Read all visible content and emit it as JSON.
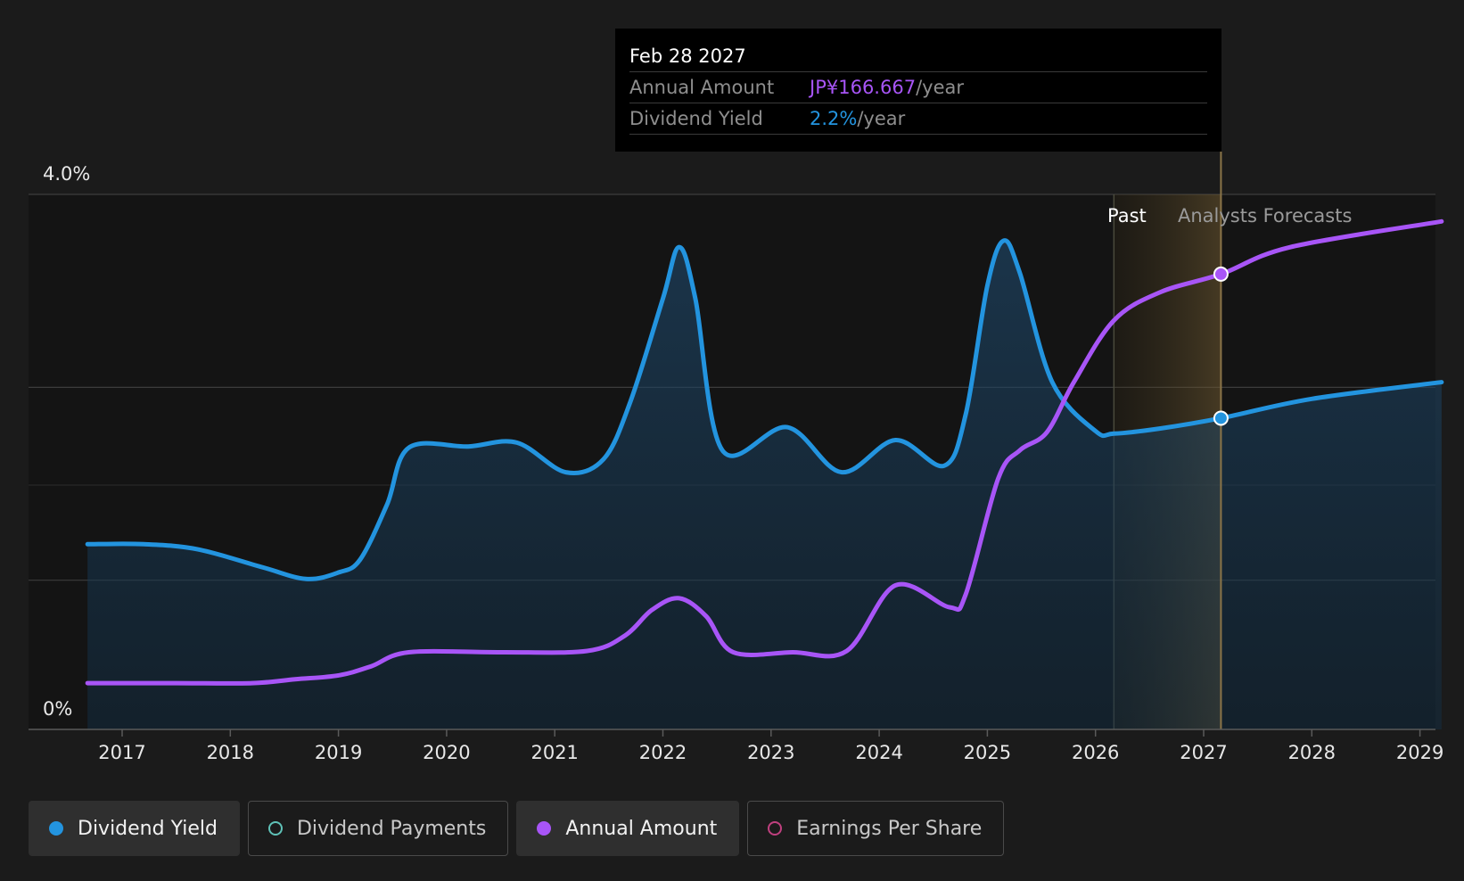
{
  "tooltip": {
    "date": "Feb 28 2027",
    "rows": [
      {
        "label": "Annual Amount",
        "value": "JP¥166.667",
        "unit": "/year",
        "color": "#a855f7"
      },
      {
        "label": "Dividend Yield",
        "value": "2.2%",
        "unit": "/year",
        "color": "#2394df"
      }
    ]
  },
  "regions": {
    "past": "Past",
    "forecast": "Analysts Forecasts"
  },
  "legend": [
    {
      "label": "Dividend Yield",
      "color": "#2394df",
      "filled": true,
      "active": true
    },
    {
      "label": "Dividend Payments",
      "color": "#5fc2b8",
      "filled": false,
      "active": false
    },
    {
      "label": "Annual Amount",
      "color": "#a855f7",
      "filled": true,
      "active": true
    },
    {
      "label": "Earnings Per Share",
      "color": "#c0407f",
      "filled": false,
      "active": false
    }
  ],
  "chart_data": {
    "type": "line",
    "title": "",
    "y_tick_labels": [
      "4.0%",
      "0%"
    ],
    "ylim": [
      0,
      4.0
    ],
    "xlim": [
      2016.65,
      2029.2
    ],
    "x_ticks": [
      "2017",
      "2018",
      "2019",
      "2020",
      "2021",
      "2022",
      "2023",
      "2024",
      "2025",
      "2026",
      "2027",
      "2028",
      "2029"
    ],
    "grid": true,
    "past_end": 2026.17,
    "forecast_highlight": [
      2026.17,
      2027.16
    ],
    "hover_x": 2027.16,
    "series": [
      {
        "name": "Dividend Yield",
        "color": "#2394df",
        "area": true,
        "points": [
          [
            2016.68,
            1.24
          ],
          [
            2017.2,
            1.24
          ],
          [
            2017.7,
            1.2
          ],
          [
            2018.3,
            1.06
          ],
          [
            2018.7,
            0.97
          ],
          [
            2019.0,
            1.02
          ],
          [
            2019.2,
            1.12
          ],
          [
            2019.45,
            1.55
          ],
          [
            2019.65,
            1.99
          ],
          [
            2020.2,
            2.0
          ],
          [
            2020.65,
            2.03
          ],
          [
            2021.1,
            1.8
          ],
          [
            2021.45,
            1.9
          ],
          [
            2021.7,
            2.35
          ],
          [
            2022.0,
            3.15
          ],
          [
            2022.15,
            3.55
          ],
          [
            2022.3,
            3.15
          ],
          [
            2022.55,
            1.97
          ],
          [
            2023.15,
            2.15
          ],
          [
            2023.65,
            1.8
          ],
          [
            2024.15,
            2.05
          ],
          [
            2024.6,
            1.85
          ],
          [
            2024.8,
            2.25
          ],
          [
            2025.0,
            3.25
          ],
          [
            2025.15,
            3.6
          ],
          [
            2025.3,
            3.35
          ],
          [
            2025.6,
            2.5
          ],
          [
            2026.0,
            2.12
          ],
          [
            2026.17,
            2.1
          ],
          [
            2026.6,
            2.14
          ],
          [
            2027.16,
            2.22
          ],
          [
            2028.0,
            2.37
          ],
          [
            2029.2,
            2.5
          ]
        ]
      },
      {
        "name": "Annual Amount",
        "color": "#a855f7",
        "area": false,
        "points": [
          [
            2016.68,
            0.16
          ],
          [
            2017.5,
            0.16
          ],
          [
            2018.2,
            0.16
          ],
          [
            2018.6,
            0.19
          ],
          [
            2019.0,
            0.22
          ],
          [
            2019.3,
            0.29
          ],
          [
            2019.65,
            0.4
          ],
          [
            2020.5,
            0.4
          ],
          [
            2021.3,
            0.41
          ],
          [
            2021.65,
            0.53
          ],
          [
            2021.9,
            0.73
          ],
          [
            2022.15,
            0.82
          ],
          [
            2022.4,
            0.68
          ],
          [
            2022.65,
            0.4
          ],
          [
            2023.2,
            0.4
          ],
          [
            2023.7,
            0.41
          ],
          [
            2024.15,
            0.92
          ],
          [
            2024.65,
            0.75
          ],
          [
            2024.8,
            0.85
          ],
          [
            2025.1,
            1.75
          ],
          [
            2025.3,
            1.97
          ],
          [
            2025.55,
            2.11
          ],
          [
            2025.8,
            2.5
          ],
          [
            2026.17,
            2.98
          ],
          [
            2026.6,
            3.2
          ],
          [
            2027.16,
            3.34
          ],
          [
            2027.8,
            3.55
          ],
          [
            2029.2,
            3.75
          ]
        ]
      }
    ]
  }
}
